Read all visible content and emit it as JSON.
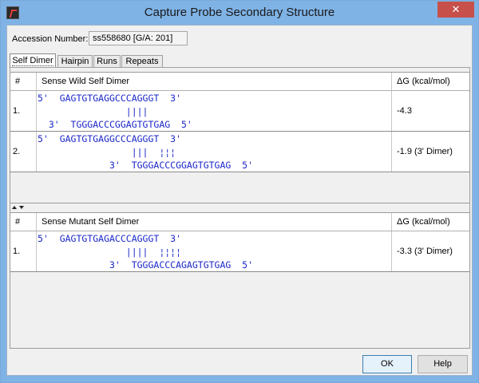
{
  "window": {
    "title": "Capture Probe Secondary Structure",
    "close_glyph": "✕",
    "icon": "app-icon"
  },
  "accession": {
    "label": "Accession Number:",
    "value": "ss558680 [G/A: 201]"
  },
  "tabs": [
    {
      "label": "Self Dimer",
      "active": true
    },
    {
      "label": "Hairpin",
      "active": false
    },
    {
      "label": "Runs",
      "active": false
    },
    {
      "label": "Repeats",
      "active": false
    }
  ],
  "wild": {
    "headers": {
      "num": "#",
      "structure": "Sense Wild Self Dimer",
      "dg": "ΔG (kcal/mol)"
    },
    "rows": [
      {
        "num": "1.",
        "lines": [
          "5'  GAGTGTGAGGCCCAGGGT  3'",
          "                ||||",
          "  3'  TGGGACCCGGAGTGTGAG  5'"
        ],
        "dg": "-4.3"
      },
      {
        "num": "2.",
        "lines": [
          "5'  GAGTGTGAGGCCCAGGGT  3'",
          "                 |||  ¦¦¦",
          "             3'  TGGGACCCGGAGTGTGAG  5'"
        ],
        "dg": "-1.9 (3' Dimer)"
      }
    ]
  },
  "mutant": {
    "headers": {
      "num": "#",
      "structure": "Sense Mutant Self Dimer",
      "dg": "ΔG (kcal/mol)"
    },
    "rows": [
      {
        "num": "1.",
        "lines": [
          "5'  GAGTGTGAGACCCAGGGT  3'",
          "                ||||  ¦¦¦¦",
          "             3'  TGGGACCCAGAGTGTGAG  5'"
        ],
        "dg": "-3.3 (3' Dimer)"
      }
    ]
  },
  "buttons": {
    "ok": "OK",
    "help": "Help"
  }
}
